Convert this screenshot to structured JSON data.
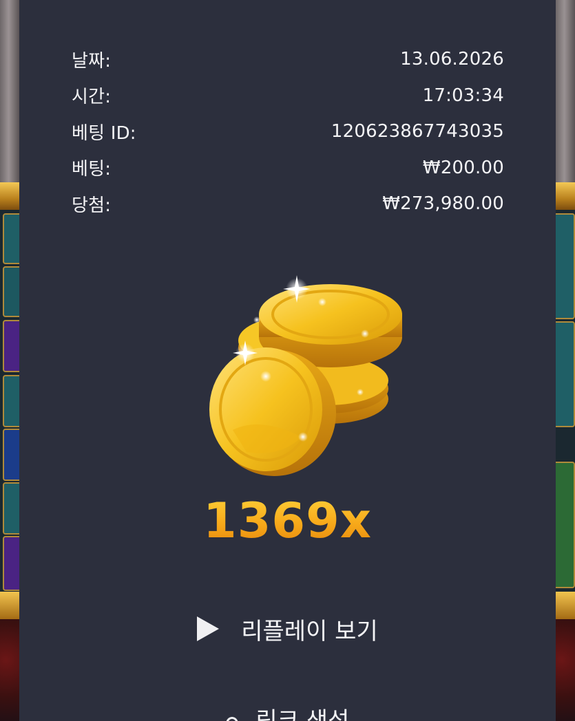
{
  "bet_details": {
    "rows": [
      {
        "label": "날짜:",
        "value": "13.06.2026"
      },
      {
        "label": "시간:",
        "value": "17:03:34"
      },
      {
        "label": "베팅 ID:",
        "value": "120623867743035"
      },
      {
        "label": "베팅:",
        "value": "₩200.00"
      },
      {
        "label": "당첨:",
        "value": "₩273,980.00"
      }
    ]
  },
  "win_display": {
    "icon": "gold-coins-icon",
    "multiplier": "1369x"
  },
  "actions": {
    "replay_icon": "play-icon",
    "replay_label": "리플레이 보기",
    "link_icon": "link-icon",
    "link_label": "링크 생성"
  },
  "colors": {
    "panel_background": "#2c2f3d",
    "text": "#f4f4f6",
    "multiplier_gold": "#f7a91a"
  }
}
